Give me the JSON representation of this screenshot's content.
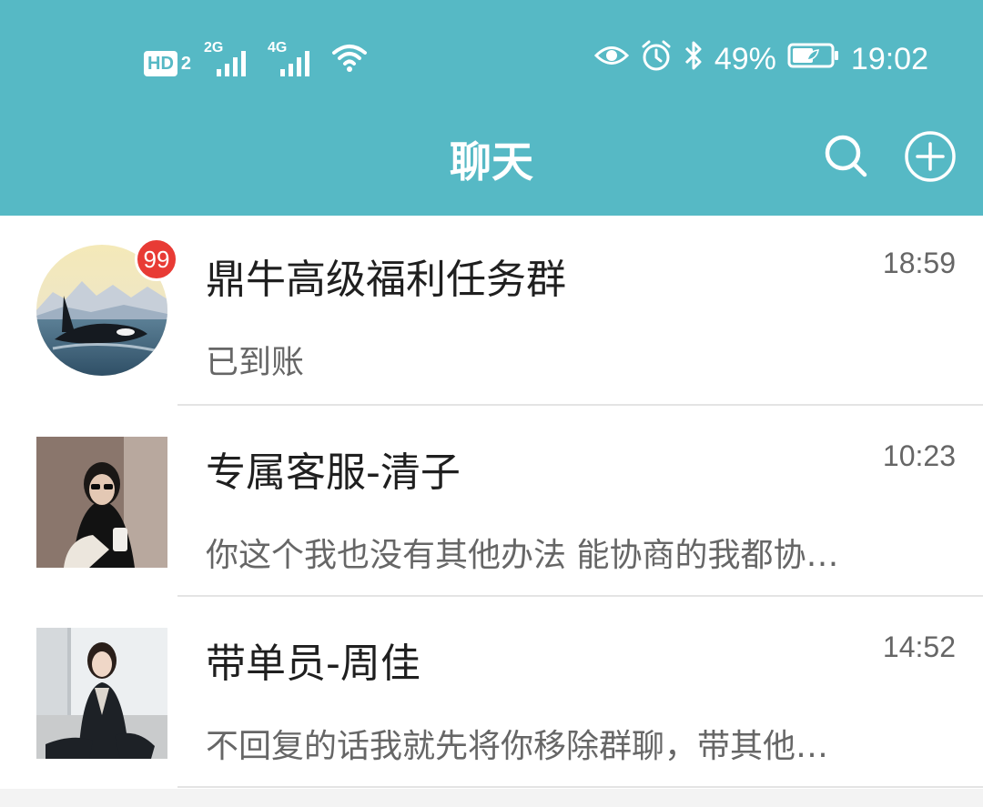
{
  "status_bar": {
    "hd_label": "HD",
    "sim_index": "2",
    "net1": "2G",
    "net2": "4G",
    "battery": "49%",
    "time": "19:02",
    "icons": [
      "hd-icon",
      "signal-2g-icon",
      "signal-4g-icon",
      "wifi-icon",
      "eye-icon",
      "alarm-icon",
      "bluetooth-icon",
      "battery-icon"
    ]
  },
  "header": {
    "title": "聊天",
    "search_icon": "search-icon",
    "add_icon": "add-circle-icon"
  },
  "chats": [
    {
      "name": "鼎牛高级福利任务群",
      "time": "18:59",
      "preview": "已到账",
      "unread": "99",
      "avatar": "orca-avatar"
    },
    {
      "name": "专属客服-清子",
      "time": "10:23",
      "preview": "你这个我也没有其他办法 能协商的我都协…",
      "avatar": "woman-sunglasses-avatar"
    },
    {
      "name": "带单员-周佳",
      "time": "14:52",
      "preview": "不回复的话我就先将你移除群聊，带其他…",
      "avatar": "woman-suit-avatar"
    }
  ],
  "colors": {
    "header_bg": "#56b9c5",
    "badge": "#e83b35",
    "text_primary": "#1f1f1f",
    "text_secondary": "#666666"
  }
}
